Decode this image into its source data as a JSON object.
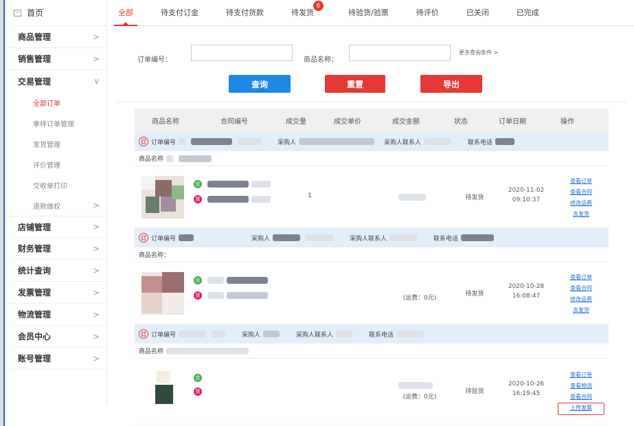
{
  "sidebar": {
    "home": "首页",
    "items_top": [
      {
        "label": "商品管理",
        "chev": ">"
      },
      {
        "label": "销售管理",
        "chev": ">"
      }
    ],
    "trade": {
      "label": "交易管理",
      "chev": "∨"
    },
    "sub": [
      {
        "label": "全部订单",
        "chev": ""
      },
      {
        "label": "拿样订单管理",
        "chev": ""
      },
      {
        "label": "发货管理",
        "chev": ""
      },
      {
        "label": "评价管理",
        "chev": ""
      },
      {
        "label": "交收单打印",
        "chev": ""
      },
      {
        "label": "退款维权",
        "chev": ">"
      }
    ],
    "items_bottom": [
      {
        "label": "店铺管理",
        "chev": ">"
      },
      {
        "label": "财务管理",
        "chev": ">"
      },
      {
        "label": "统计查询",
        "chev": ">"
      },
      {
        "label": "发票管理",
        "chev": ">"
      },
      {
        "label": "物流管理",
        "chev": ">"
      },
      {
        "label": "会员中心",
        "chev": ">"
      },
      {
        "label": "账号管理",
        "chev": ">"
      }
    ]
  },
  "tabs": [
    "全部",
    "待支付订金",
    "待支付货款",
    "待发货",
    "待验货/验票",
    "待评价",
    "已关闭",
    "已完成"
  ],
  "tab_badge": "6",
  "filter": {
    "order_no_label": "订单编号：",
    "product_label": "商品名称：",
    "more": "更多查询条件 >",
    "search": "查询",
    "reset": "重置",
    "export": "导出"
  },
  "table_head": [
    "商品名称",
    "合同编号",
    "成交量",
    "成交单价",
    "成交金额",
    "状态",
    "订单日期",
    "操作"
  ],
  "order_labels": {
    "order_no": "订单编号",
    "buyer": "采购人",
    "buyer_contact": "采购人联系人",
    "phone": "联系电话",
    "product_name": "商品名称：",
    "product_name2": "商品名称",
    "tag_g": "合",
    "tag_p": "货"
  },
  "orders": [
    {
      "qty": "1",
      "amount": "",
      "status": "待发货",
      "date": "2020-11-02",
      "time": "09:10:37",
      "ops": [
        "查看订单",
        "查看合同",
        "修改运费",
        "去发货"
      ]
    },
    {
      "qty": "",
      "amount": "(运费：0元)",
      "status": "待发货",
      "date": "2020-10-28",
      "time": "16:08:47",
      "ops": [
        "查看订单",
        "查看合同",
        "修改运费",
        "去发货"
      ]
    },
    {
      "qty": "",
      "amount": "(运费：0元)",
      "status": "待验货",
      "date": "2020-10-26",
      "time": "16:19:45",
      "ops": [
        "查看订单",
        "查看物流",
        "查看合同",
        "上传发票"
      ]
    }
  ],
  "colors": {
    "accent": "#e53935",
    "primary": "#1e88e5",
    "link": "#1e6fd9"
  }
}
